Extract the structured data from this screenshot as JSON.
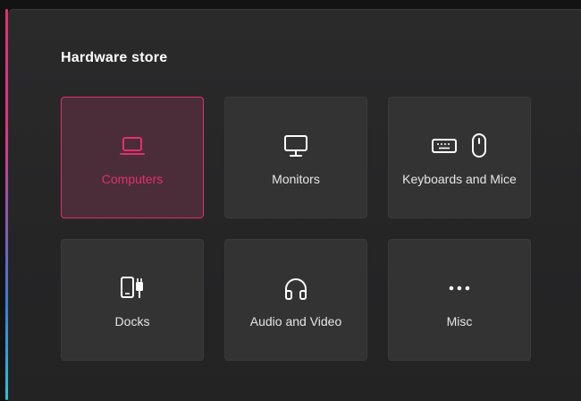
{
  "store": {
    "title": "Hardware store"
  },
  "categories": [
    {
      "label": "Computers",
      "icon": "laptop-icon",
      "selected": true
    },
    {
      "label": "Monitors",
      "icon": "monitor-icon",
      "selected": false
    },
    {
      "label": "Keyboards and Mice",
      "icon": "keyboard-mouse-icon",
      "selected": false
    },
    {
      "label": "Docks",
      "icon": "dock-icon",
      "selected": false
    },
    {
      "label": "Audio and Video",
      "icon": "headphones-icon",
      "selected": false
    },
    {
      "label": "Misc",
      "icon": "more-icon",
      "selected": false
    }
  ],
  "colors": {
    "accent": "#e0306f",
    "tile": "#333334",
    "panel": "#2a2a2b"
  }
}
